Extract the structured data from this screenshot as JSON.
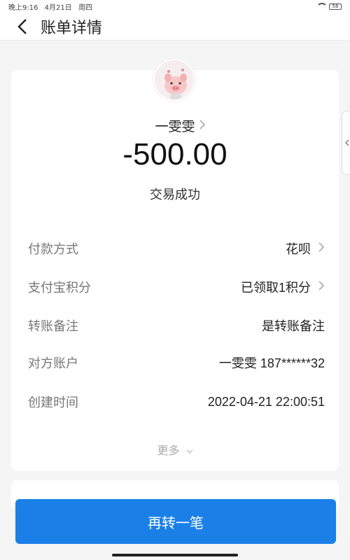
{
  "status_bar": {
    "time": "晚上9:16",
    "date": "4月21日",
    "weekday": "周四",
    "battery": "58"
  },
  "header": {
    "title": "账单详情"
  },
  "payee": {
    "name": "一雯雯"
  },
  "transaction": {
    "amount": "-500.00",
    "status": "交易成功"
  },
  "details": [
    {
      "label": "付款方式",
      "value": "花呗"
    },
    {
      "label": "支付宝积分",
      "value": "已领取1积分"
    },
    {
      "label": "转账备注",
      "value": "是转账备注"
    },
    {
      "label": "对方账户",
      "value": "一雯雯 187******32"
    },
    {
      "label": "创建时间",
      "value": "2022-04-21 22:00:51"
    }
  ],
  "more": {
    "label": "更多"
  },
  "action": {
    "label": "再转一笔"
  },
  "colors": {
    "primary": "#1a80e8",
    "background": "#f5f5f5"
  },
  "icons": [
    "back-icon",
    "chevron-right-icon",
    "chevron-down-icon",
    "chevron-left-icon",
    "wifi-icon",
    "battery-icon"
  ]
}
